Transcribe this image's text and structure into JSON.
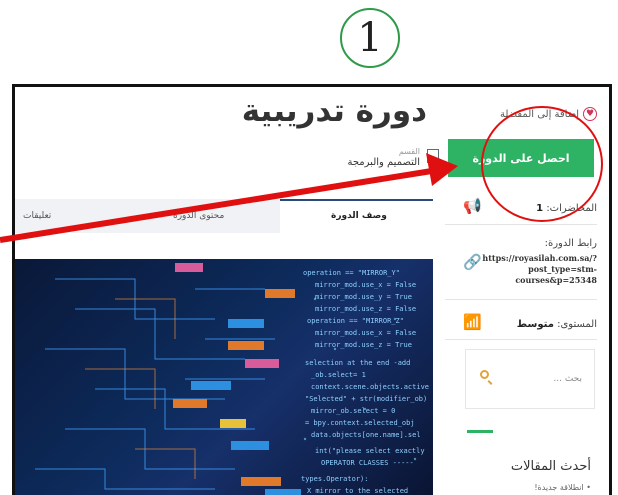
{
  "step": {
    "number": "1"
  },
  "page": {
    "title": "دورة تدريبية",
    "wishlist_label": "إضافة إلى المفضلة",
    "category_label": "القسم",
    "category_value": "التصميم والبرمجة"
  },
  "sidebar": {
    "enroll_button": "احصل على الدورة",
    "lectures_label": "المحاضرات:",
    "lectures_value": "1",
    "course_link_label": "رابط الدورة:",
    "course_link_lines": [
      "https://royasilah.com.sa/?",
      "post_type=stm-",
      "courses&p=25348"
    ],
    "level_label": "المستوى:",
    "level_value": "متوسط",
    "search_placeholder": "بحث ...",
    "recent_posts_title": "أحدث المقالات",
    "recent_posts_first": "انطلاقة جديدة!"
  },
  "tabs": [
    {
      "label": "وصف الدورة",
      "active": true
    },
    {
      "label": "محتوى الدورة",
      "active": false
    },
    {
      "label": "تعليقات",
      "active": false
    }
  ],
  "colors": {
    "accent_green": "#2eb365",
    "annotation_red": "#e01010",
    "tab_active_border": "#2b4a7a"
  },
  "icons": {
    "wishlist": "heart-icon",
    "category": "bookmark-icon",
    "lectures": "megaphone-icon",
    "course_link": "link-icon",
    "level": "bar-chart-icon",
    "search": "search-icon"
  }
}
